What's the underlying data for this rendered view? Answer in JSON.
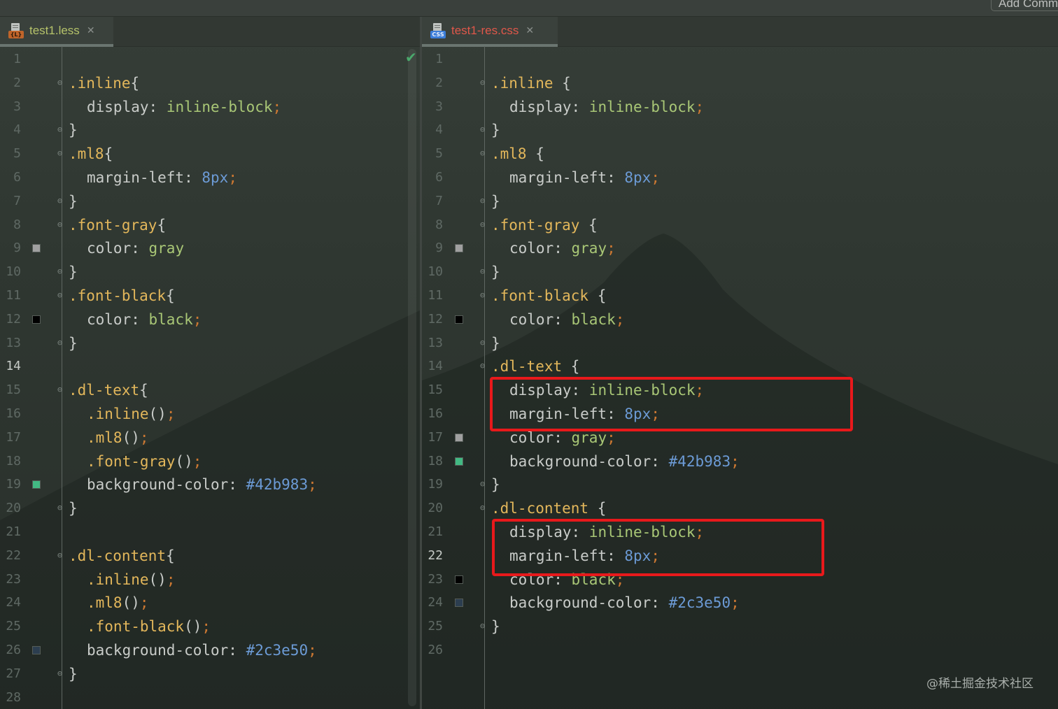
{
  "topbar": {
    "button_label": "Add Comm"
  },
  "left": {
    "tab": {
      "name": "test1.less",
      "badge": "{L}",
      "close": "✕",
      "name_color": "#b5c26a",
      "badge_color": "#c0642a"
    },
    "checkmark": "✔",
    "current_line": 14,
    "lines": [
      {
        "n": 1,
        "tokens": []
      },
      {
        "n": 2,
        "fold": "open",
        "tokens": [
          [
            ".inline",
            "sel"
          ],
          [
            "{",
            "punc"
          ]
        ]
      },
      {
        "n": 3,
        "indent": 1,
        "tokens": [
          [
            "display",
            "prop"
          ],
          [
            ": ",
            "punc"
          ],
          [
            "inline-block",
            "val"
          ],
          [
            ";",
            "semi"
          ]
        ]
      },
      {
        "n": 4,
        "fold": "close",
        "tokens": [
          [
            "}",
            "punc"
          ]
        ]
      },
      {
        "n": 5,
        "fold": "open",
        "tokens": [
          [
            ".ml8",
            "sel"
          ],
          [
            "{",
            "punc"
          ]
        ]
      },
      {
        "n": 6,
        "indent": 1,
        "tokens": [
          [
            "margin-left",
            "prop"
          ],
          [
            ": ",
            "punc"
          ],
          [
            "8px",
            "num"
          ],
          [
            ";",
            "semi"
          ]
        ]
      },
      {
        "n": 7,
        "fold": "close",
        "tokens": [
          [
            "}",
            "punc"
          ]
        ]
      },
      {
        "n": 8,
        "fold": "open",
        "tokens": [
          [
            ".font-gray",
            "sel"
          ],
          [
            "{",
            "punc"
          ]
        ]
      },
      {
        "n": 9,
        "indent": 1,
        "swatch": "#a0a0a0",
        "tokens": [
          [
            "color",
            "prop"
          ],
          [
            ": ",
            "punc"
          ],
          [
            "gray",
            "val"
          ]
        ]
      },
      {
        "n": 10,
        "fold": "close",
        "tokens": [
          [
            "}",
            "punc"
          ]
        ]
      },
      {
        "n": 11,
        "fold": "open",
        "tokens": [
          [
            ".font-black",
            "sel"
          ],
          [
            "{",
            "punc"
          ]
        ]
      },
      {
        "n": 12,
        "indent": 1,
        "swatch": "#000000",
        "tokens": [
          [
            "color",
            "prop"
          ],
          [
            ": ",
            "punc"
          ],
          [
            "black",
            "val"
          ],
          [
            ";",
            "semi"
          ]
        ]
      },
      {
        "n": 13,
        "fold": "close",
        "tokens": [
          [
            "}",
            "punc"
          ]
        ]
      },
      {
        "n": 14,
        "tokens": []
      },
      {
        "n": 15,
        "fold": "open",
        "tokens": [
          [
            ".dl-text",
            "sel"
          ],
          [
            "{",
            "punc"
          ]
        ]
      },
      {
        "n": 16,
        "indent": 1,
        "tokens": [
          [
            ".inline",
            "sel"
          ],
          [
            "()",
            "punc"
          ],
          [
            ";",
            "semi"
          ]
        ]
      },
      {
        "n": 17,
        "indent": 1,
        "tokens": [
          [
            ".ml8",
            "sel"
          ],
          [
            "()",
            "punc"
          ],
          [
            ";",
            "semi"
          ]
        ]
      },
      {
        "n": 18,
        "indent": 1,
        "tokens": [
          [
            ".font-gray",
            "sel"
          ],
          [
            "()",
            "punc"
          ],
          [
            ";",
            "semi"
          ]
        ]
      },
      {
        "n": 19,
        "indent": 1,
        "swatch": "#42b983",
        "tokens": [
          [
            "background-color",
            "prop"
          ],
          [
            ": ",
            "punc"
          ],
          [
            "#42b983",
            "num"
          ],
          [
            ";",
            "semi"
          ]
        ]
      },
      {
        "n": 20,
        "fold": "close",
        "tokens": [
          [
            "}",
            "punc"
          ]
        ]
      },
      {
        "n": 21,
        "tokens": []
      },
      {
        "n": 22,
        "fold": "open",
        "tokens": [
          [
            ".dl-content",
            "sel"
          ],
          [
            "{",
            "punc"
          ]
        ]
      },
      {
        "n": 23,
        "indent": 1,
        "tokens": [
          [
            ".inline",
            "sel"
          ],
          [
            "()",
            "punc"
          ],
          [
            ";",
            "semi"
          ]
        ]
      },
      {
        "n": 24,
        "indent": 1,
        "tokens": [
          [
            ".ml8",
            "sel"
          ],
          [
            "()",
            "punc"
          ],
          [
            ";",
            "semi"
          ]
        ]
      },
      {
        "n": 25,
        "indent": 1,
        "tokens": [
          [
            ".font-black",
            "sel"
          ],
          [
            "()",
            "punc"
          ],
          [
            ";",
            "semi"
          ]
        ]
      },
      {
        "n": 26,
        "indent": 1,
        "swatch": "#2c3e50",
        "tokens": [
          [
            "background-color",
            "prop"
          ],
          [
            ": ",
            "punc"
          ],
          [
            "#2c3e50",
            "num"
          ],
          [
            ";",
            "semi"
          ]
        ]
      },
      {
        "n": 27,
        "fold": "close",
        "tokens": [
          [
            "}",
            "punc"
          ]
        ]
      },
      {
        "n": 28,
        "tokens": []
      }
    ]
  },
  "right": {
    "tab": {
      "name": "test1-res.css",
      "badge": "CSS",
      "close": "✕",
      "name_color": "#e0574a",
      "badge_color": "#3b7dd8"
    },
    "current_line": 22,
    "lines": [
      {
        "n": 1,
        "tokens": []
      },
      {
        "n": 2,
        "fold": "open",
        "tokens": [
          [
            ".inline",
            "sel"
          ],
          [
            " {",
            "punc"
          ]
        ]
      },
      {
        "n": 3,
        "indent": 1,
        "tokens": [
          [
            "display",
            "prop"
          ],
          [
            ": ",
            "punc"
          ],
          [
            "inline-block",
            "val"
          ],
          [
            ";",
            "semi"
          ]
        ]
      },
      {
        "n": 4,
        "fold": "close",
        "tokens": [
          [
            "}",
            "punc"
          ]
        ]
      },
      {
        "n": 5,
        "fold": "open",
        "tokens": [
          [
            ".ml8",
            "sel"
          ],
          [
            " {",
            "punc"
          ]
        ]
      },
      {
        "n": 6,
        "indent": 1,
        "tokens": [
          [
            "margin-left",
            "prop"
          ],
          [
            ": ",
            "punc"
          ],
          [
            "8px",
            "num"
          ],
          [
            ";",
            "semi"
          ]
        ]
      },
      {
        "n": 7,
        "fold": "close",
        "tokens": [
          [
            "}",
            "punc"
          ]
        ]
      },
      {
        "n": 8,
        "fold": "open",
        "tokens": [
          [
            ".font-gray",
            "sel"
          ],
          [
            " {",
            "punc"
          ]
        ]
      },
      {
        "n": 9,
        "indent": 1,
        "swatch": "#a0a0a0",
        "tokens": [
          [
            "color",
            "prop"
          ],
          [
            ": ",
            "punc"
          ],
          [
            "gray",
            "val"
          ],
          [
            ";",
            "semi"
          ]
        ]
      },
      {
        "n": 10,
        "fold": "close",
        "tokens": [
          [
            "}",
            "punc"
          ]
        ]
      },
      {
        "n": 11,
        "fold": "open",
        "tokens": [
          [
            ".font-black",
            "sel"
          ],
          [
            " {",
            "punc"
          ]
        ]
      },
      {
        "n": 12,
        "indent": 1,
        "swatch": "#000000",
        "tokens": [
          [
            "color",
            "prop"
          ],
          [
            ": ",
            "punc"
          ],
          [
            "black",
            "val"
          ],
          [
            ";",
            "semi"
          ]
        ]
      },
      {
        "n": 13,
        "fold": "close",
        "tokens": [
          [
            "}",
            "punc"
          ]
        ]
      },
      {
        "n": 14,
        "fold": "open",
        "tokens": [
          [
            ".dl-text",
            "sel"
          ],
          [
            " {",
            "punc"
          ]
        ]
      },
      {
        "n": 15,
        "indent": 1,
        "tokens": [
          [
            "display",
            "prop"
          ],
          [
            ": ",
            "punc"
          ],
          [
            "inline-block",
            "val"
          ],
          [
            ";",
            "semi"
          ]
        ]
      },
      {
        "n": 16,
        "indent": 1,
        "tokens": [
          [
            "margin-left",
            "prop"
          ],
          [
            ": ",
            "punc"
          ],
          [
            "8px",
            "num"
          ],
          [
            ";",
            "semi"
          ]
        ]
      },
      {
        "n": 17,
        "indent": 1,
        "swatch": "#a0a0a0",
        "tokens": [
          [
            "color",
            "prop"
          ],
          [
            ": ",
            "punc"
          ],
          [
            "gray",
            "val"
          ],
          [
            ";",
            "semi"
          ]
        ]
      },
      {
        "n": 18,
        "indent": 1,
        "swatch": "#42b983",
        "tokens": [
          [
            "background-color",
            "prop"
          ],
          [
            ": ",
            "punc"
          ],
          [
            "#42b983",
            "num"
          ],
          [
            ";",
            "semi"
          ]
        ]
      },
      {
        "n": 19,
        "fold": "close",
        "tokens": [
          [
            "}",
            "punc"
          ]
        ]
      },
      {
        "n": 20,
        "fold": "open",
        "tokens": [
          [
            ".dl-content",
            "sel"
          ],
          [
            " {",
            "punc"
          ]
        ]
      },
      {
        "n": 21,
        "indent": 1,
        "tokens": [
          [
            "display",
            "prop"
          ],
          [
            ": ",
            "punc"
          ],
          [
            "inline-block",
            "val"
          ],
          [
            ";",
            "semi"
          ]
        ]
      },
      {
        "n": 22,
        "indent": 1,
        "tokens": [
          [
            "margin-left",
            "prop"
          ],
          [
            ": ",
            "punc"
          ],
          [
            "8px",
            "num"
          ],
          [
            ";",
            "semi"
          ]
        ]
      },
      {
        "n": 23,
        "indent": 1,
        "swatch": "#000000",
        "tokens": [
          [
            "color",
            "prop"
          ],
          [
            ": ",
            "punc"
          ],
          [
            "black",
            "val"
          ],
          [
            ";",
            "semi"
          ]
        ]
      },
      {
        "n": 24,
        "indent": 1,
        "swatch": "#2c3e50",
        "tokens": [
          [
            "background-color",
            "prop"
          ],
          [
            ": ",
            "punc"
          ],
          [
            "#2c3e50",
            "num"
          ],
          [
            ";",
            "semi"
          ]
        ]
      },
      {
        "n": 25,
        "fold": "close",
        "tokens": [
          [
            "}",
            "punc"
          ]
        ]
      },
      {
        "n": 26,
        "tokens": []
      }
    ],
    "highlight_color": "#e8191b"
  },
  "watermark": "@稀土掘金技术社区"
}
